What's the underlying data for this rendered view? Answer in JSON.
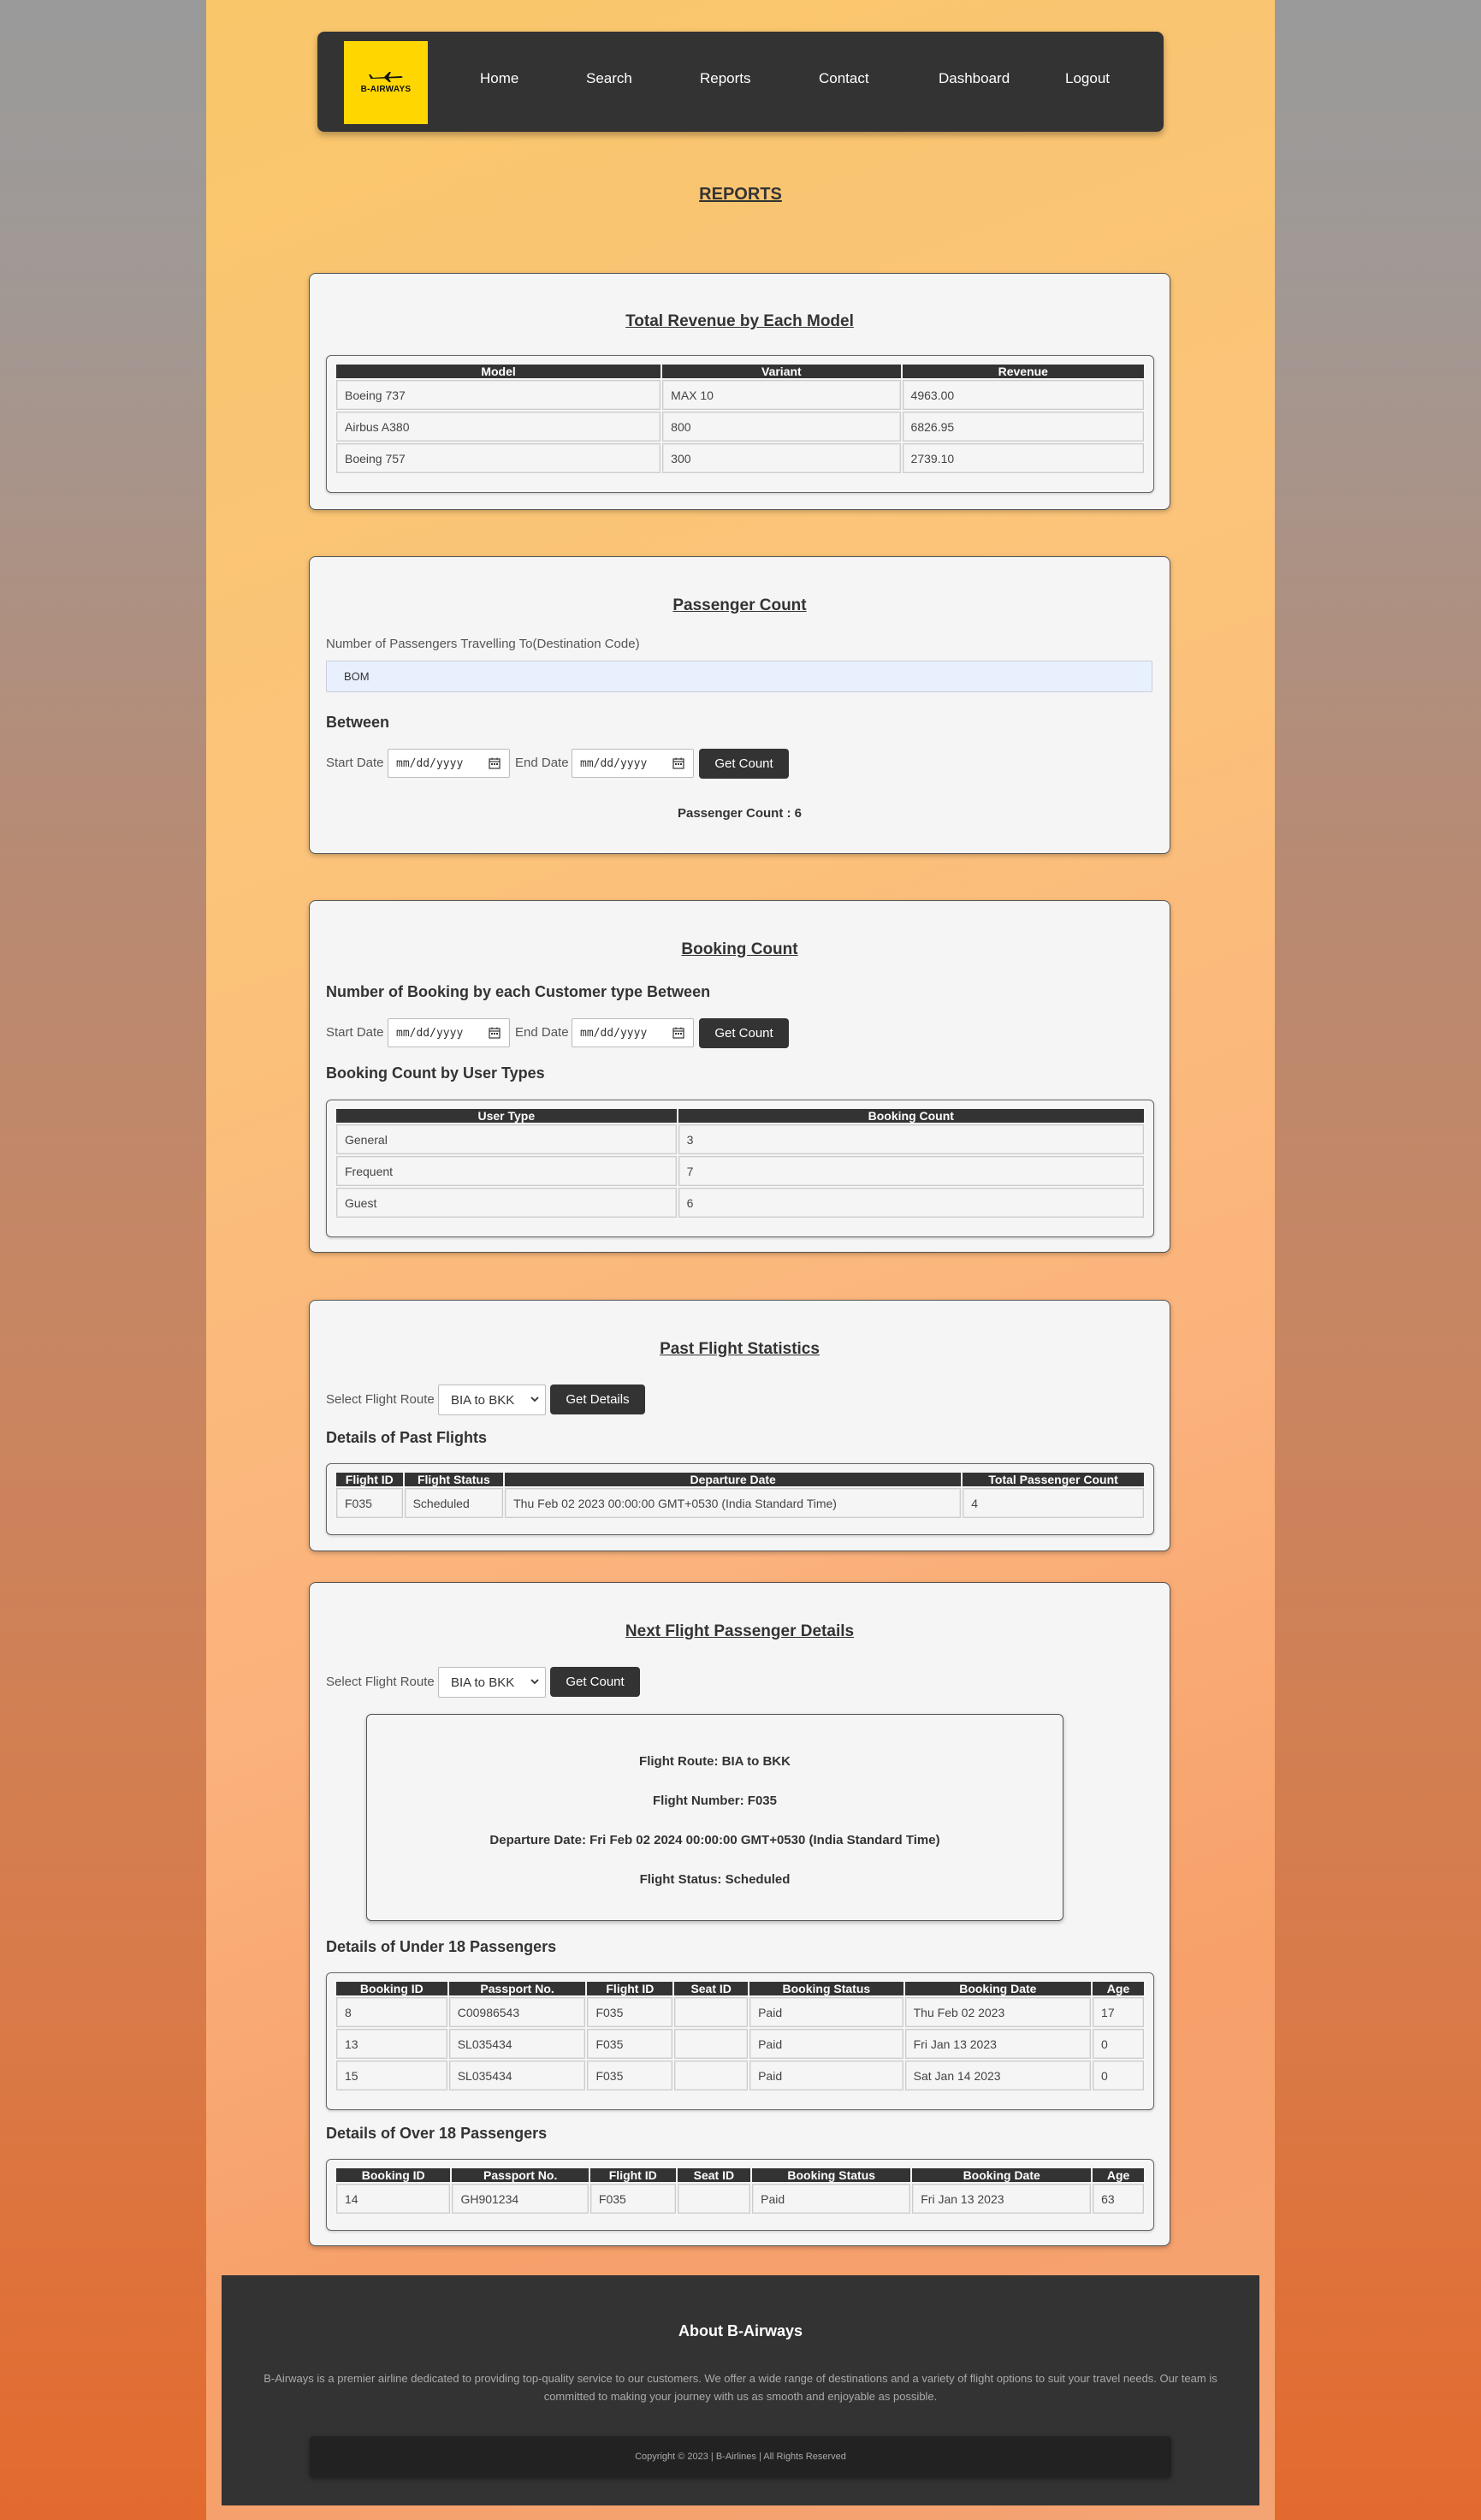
{
  "nav": {
    "logo_text": "B-AIRWAYS",
    "items": [
      "Home",
      "Search",
      "Reports",
      "Contact",
      "Dashboard",
      "Logout"
    ]
  },
  "page_title": "REPORTS",
  "revenue": {
    "title": "Total Revenue by Each Model",
    "headers": [
      "Model",
      "Variant",
      "Revenue"
    ],
    "rows": [
      [
        "Boeing 737",
        "MAX 10",
        "4963.00"
      ],
      [
        "Airbus A380",
        "800",
        "6826.95"
      ],
      [
        "Boeing 757",
        "300",
        "2739.10"
      ]
    ]
  },
  "passenger_count": {
    "title": "Passenger Count",
    "label": "Number of Passengers Travelling To(Destination Code)",
    "destination_value": "BOM",
    "between": "Between",
    "start_label": "Start Date",
    "end_label": "End Date",
    "date_placeholder": "mm/dd/yyyy",
    "button": "Get Count",
    "result": "Passenger Count : 6"
  },
  "booking_count": {
    "title": "Booking Count",
    "subtitle": "Number of Booking by each Customer type Between",
    "start_label": "Start Date",
    "end_label": "End Date",
    "date_placeholder": "mm/dd/yyyy",
    "button": "Get Count",
    "table_heading": "Booking Count by User Types",
    "headers": [
      "User Type",
      "Booking Count"
    ],
    "rows": [
      [
        "General",
        "3"
      ],
      [
        "Frequent",
        "7"
      ],
      [
        "Guest",
        "6"
      ]
    ]
  },
  "past_flights": {
    "title": "Past Flight Statistics",
    "select_label": "Select Flight Route",
    "selected_route": "BIA to BKK",
    "button": "Get Details",
    "table_heading": "Details of Past Flights",
    "headers": [
      "Flight ID",
      "Flight Status",
      "Departure Date",
      "Total Passenger Count"
    ],
    "rows": [
      [
        "F035",
        "Scheduled",
        "Thu Feb 02 2023 00:00:00 GMT+0530 (India Standard Time)",
        "4"
      ]
    ]
  },
  "next_flight": {
    "title": "Next Flight Passenger Details",
    "select_label": "Select Flight Route",
    "selected_route": "BIA to BKK",
    "button": "Get Count",
    "details": [
      "Flight Route: BIA to BKK",
      "Flight Number: F035",
      "Departure Date: Fri Feb 02 2024 00:00:00 GMT+0530 (India Standard Time)",
      "Flight Status: Scheduled"
    ],
    "under18_heading": "Details of Under 18 Passengers",
    "over18_heading": "Details of Over 18 Passengers",
    "headers": [
      "Booking ID",
      "Passport No.",
      "Flight ID",
      "Seat ID",
      "Booking Status",
      "Booking Date",
      "Age"
    ],
    "under18_rows": [
      [
        "8",
        "C00986543",
        "F035",
        "",
        "Paid",
        "Thu Feb 02 2023",
        "17"
      ],
      [
        "13",
        "SL035434",
        "F035",
        "",
        "Paid",
        "Fri Jan 13 2023",
        "0"
      ],
      [
        "15",
        "SL035434",
        "F035",
        "",
        "Paid",
        "Sat Jan 14 2023",
        "0"
      ]
    ],
    "over18_rows": [
      [
        "14",
        "GH901234",
        "F035",
        "",
        "Paid",
        "Fri Jan 13 2023",
        "63"
      ]
    ]
  },
  "footer": {
    "title": "About B-Airways",
    "text": "B-Airways is a premier airline dedicated to providing top-quality service to our customers. We offer a wide range of destinations and a variety of flight options to suit your travel needs. Our team is committed to making your journey with us as smooth and enjoyable as possible.",
    "copyright": "Copyright © 2023 | B-Airlines | All Rights Reserved"
  }
}
